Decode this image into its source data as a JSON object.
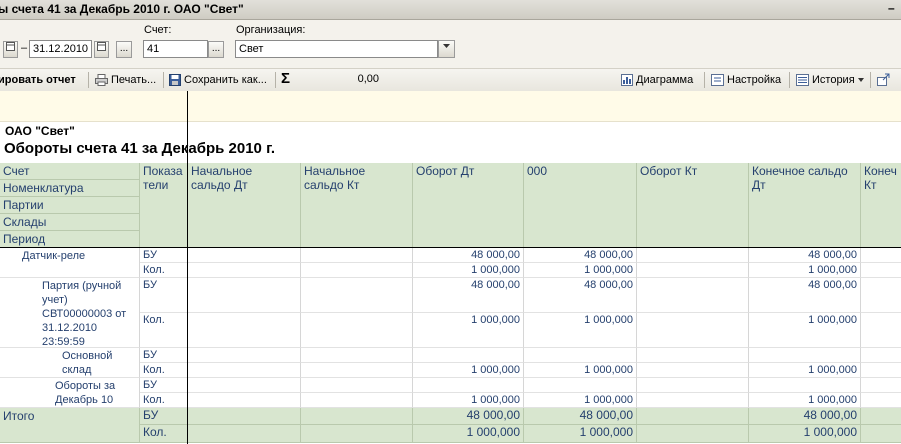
{
  "window": {
    "title": "ы счета 41 за Декабрь 2010 г. ОАО \"Свет\"",
    "corner": "–"
  },
  "params": {
    "date_to": "31.12.2010",
    "date_sep": "–",
    "schet_label": "Счет:",
    "schet_value": "41",
    "org_label": "Организация:",
    "org_value": "Свет",
    "ellipsis": "..."
  },
  "toolbar": {
    "generate": "ировать отчет",
    "print": "Печать...",
    "save": "Сохранить как...",
    "sum_symbol": "Σ",
    "sum_value": "0,00",
    "chart": "Диаграмма",
    "settings": "Настройка",
    "history": "История"
  },
  "report": {
    "org": "ОАО \"Свет\"",
    "title": "Обороты счета 41 за Декабрь 2010 г."
  },
  "table": {
    "groupings": [
      "Счет",
      "Номенклатура",
      "Партии",
      "Склады",
      "Период"
    ],
    "headers": {
      "indicators": "Показа\nтели",
      "nach_dt": "Начальное\nсальдо Дт",
      "nach_kt": "Начальное\nсальдо Кт",
      "oborot_dt": "Оборот Дт",
      "c000": "000",
      "oborot_kt": "Оборот Кт",
      "kon_dt": "Конечное сальдо\nДт",
      "kon_kt": "Конеч\nКт"
    },
    "rows": [
      {
        "name": "Датчик-реле",
        "ind": [
          "БУ",
          "Кол."
        ],
        "oborot_dt": [
          "48 000,00",
          "1 000,000"
        ],
        "c000": [
          "48 000,00",
          "1 000,000"
        ],
        "kon_dt": [
          "48 000,00",
          "1 000,000"
        ]
      },
      {
        "name": "Партия (ручной\nучет)\nСВТ00000003 от\n31.12.2010\n23:59:59",
        "ind": [
          "БУ",
          "Кол."
        ],
        "oborot_dt": [
          "48 000,00",
          "1 000,000"
        ],
        "c000": [
          "48 000,00",
          "1 000,000"
        ],
        "kon_dt": [
          "48 000,00",
          "1 000,000"
        ]
      },
      {
        "name": "Основной\nсклад",
        "ind": [
          "БУ",
          "Кол."
        ],
        "oborot_dt": [
          "",
          "1 000,000"
        ],
        "c000": [
          "",
          "1 000,000"
        ],
        "kon_dt": [
          "",
          "1 000,000"
        ]
      },
      {
        "name": "Обороты за\nДекабрь 10",
        "ind": [
          "БУ",
          "Кол."
        ],
        "oborot_dt": [
          "",
          "1 000,000"
        ],
        "c000": [
          "",
          "1 000,000"
        ],
        "kon_dt": [
          "",
          "1 000,000"
        ]
      }
    ],
    "total": {
      "name": "Итого",
      "ind": [
        "БУ",
        "Кол."
      ],
      "oborot_dt": [
        "48 000,00",
        "1 000,000"
      ],
      "c000": [
        "48 000,00",
        "1 000,000"
      ],
      "kon_dt": [
        "48 000,00",
        "1 000,000"
      ]
    }
  },
  "colors": {
    "header_bg": "#d8e6cf",
    "text_blue": "#25406e",
    "yellow_bar": "#fffbe8"
  }
}
